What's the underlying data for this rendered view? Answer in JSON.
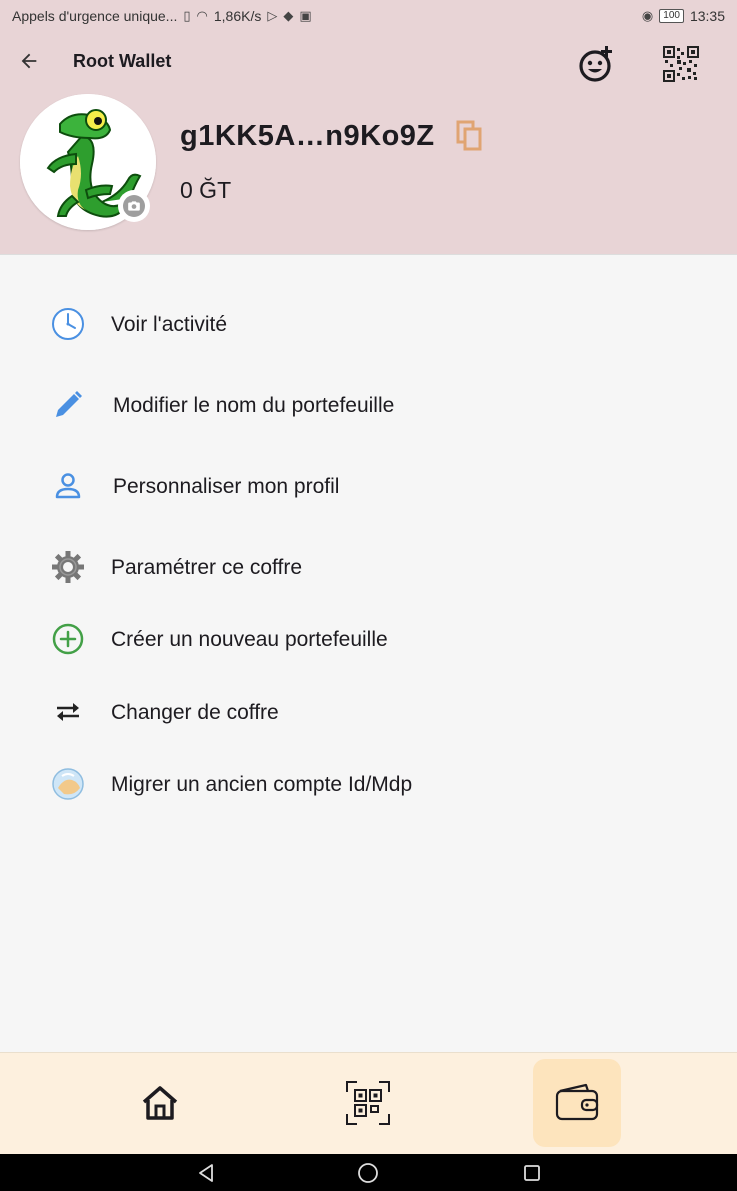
{
  "status_bar": {
    "notification_text": "Appels d'urgence unique...",
    "network_speed": "1,86K/s",
    "battery": "100",
    "time": "13:35"
  },
  "app_bar": {
    "title": "Root Wallet",
    "icons": [
      "back-arrow-icon",
      "emoji-add-icon",
      "qr-code-icon"
    ]
  },
  "wallet": {
    "address": "g1KK5A…n9Ko9Z",
    "balance": "0 ĞT",
    "avatar": "gecko-avatar",
    "accent_color": "#e0a472"
  },
  "menu": {
    "items": [
      {
        "label": "Voir l'activité",
        "icon": "clock-icon"
      },
      {
        "label": "Modifier le nom du portefeuille",
        "icon": "pencil-icon"
      },
      {
        "label": "Personnaliser mon profil",
        "icon": "person-icon"
      },
      {
        "label": "Paramétrer ce coffre",
        "icon": "gear-icon"
      },
      {
        "label": "Créer un nouveau portefeuille",
        "icon": "add-circle-icon"
      },
      {
        "label": "Changer de coffre",
        "icon": "swap-arrows-icon"
      },
      {
        "label": "Migrer un ancien compte Id/Mdp",
        "icon": "migrate-icon"
      }
    ]
  },
  "bottom_nav": {
    "items": [
      "home-icon",
      "qr-scan-icon",
      "wallet-icon"
    ],
    "active": "wallet-icon",
    "background": "#fdf0de",
    "active_background": "#fde4bd"
  },
  "colors": {
    "header_bg": "#e8d4d6",
    "body_bg": "#f6f6f6",
    "icon_blue": "#4a90e2",
    "icon_green": "#43a047"
  }
}
